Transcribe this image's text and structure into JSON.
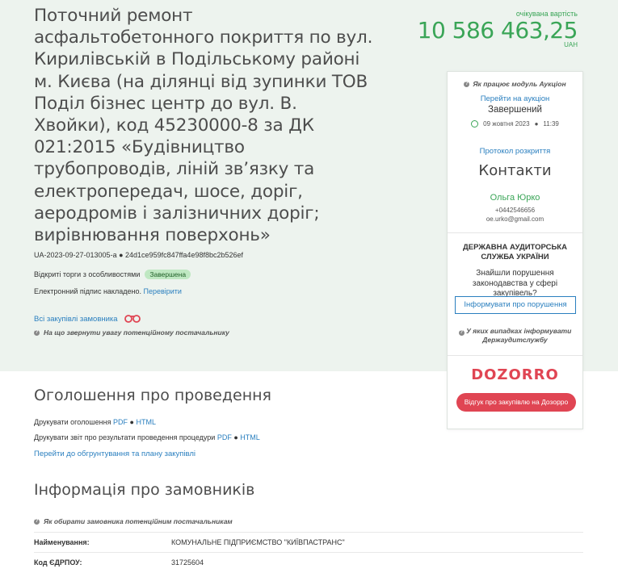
{
  "tender": {
    "title": "Поточний ремонт асфальтобетонного покриття по вул. Кирилівській в Подільському районі м. Києва (на ділянці від зупинки ТОВ Поділ бізнес центр до вул. В. Хвойки), код 45230000-8 за ДК 021:2015 «Будівництво трубопроводів, ліній зв’язку та електропередач, шосе, доріг, аеродромів і залізничних доріг; вирівнювання поверхонь»",
    "id": "UA-2023-09-27-013005-a",
    "hash": "24d1ce959fc847ffa4e98f8bc2b526ef",
    "procedure": "Відкриті торги з особливостями",
    "status": "Завершена",
    "signature_text": "Електронний підпис накладено.",
    "verify_link": "Перевірити",
    "all_purchases_link": "Всі закупівлі замовника",
    "attention_note": "На що звернути увагу потенційному постачальнику"
  },
  "expected_value": {
    "label": "очікувана вартість",
    "amount": "10 586 463,25",
    "currency": "UAH"
  },
  "sidebar": {
    "auction_how": "Як працює модуль Аукціон",
    "auction_link": "Перейти на аукціон",
    "auction_status": "Завершений",
    "auction_date": "09 жовтня 2023",
    "auction_time": "11:39",
    "protocol_link": "Протокол розкриття",
    "contacts_title": "Контакти",
    "contact_name": "Ольга Юрко",
    "contact_phone": "+0442546656",
    "contact_email": "oe.urko@gmail.com",
    "dasu_title": "ДЕРЖАВНА АУДИТОРСЬКА СЛУЖБА УКРАЇНИ",
    "dasu_question": "Знайшли порушення законодавства у сфері закупівель?",
    "inform_button": "Інформувати про порушення",
    "dasu_note": "У яких випадках інформувати Держаудитслужбу",
    "dozorro_logo": "DOZORRO",
    "dozorro_button": "Відгук про закупівлю на Дозорро"
  },
  "announcement": {
    "heading": "Оголошення про проведення",
    "print_label": "Друкувати оголошення",
    "print_report_label": "Друкувати звіт про результати проведення процедури",
    "pdf": "PDF",
    "html": "HTML",
    "plan_link": "Перейти до обгрунтування та плану закупівлі"
  },
  "customers": {
    "heading": "Інформація про замовників",
    "how_to_choose": "Як обирати замовника потенційним постачальникам",
    "rows": [
      {
        "key": "Найменування:",
        "value": "КОМУНАЛЬНЕ ПІДПРИЄМСТВО \"КИЇВПАСТРАНС\""
      },
      {
        "key": "Код ЄДРПОУ:",
        "value": "31725604"
      }
    ]
  }
}
